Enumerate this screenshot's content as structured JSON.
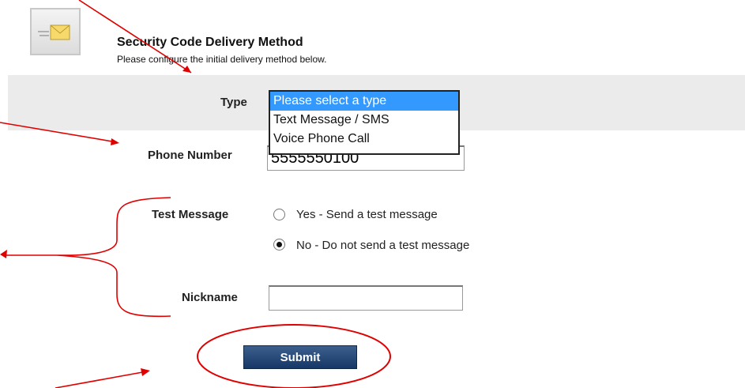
{
  "header": {
    "title": "Security Code Delivery Method",
    "subtitle": "Please configure the initial delivery method below."
  },
  "type": {
    "label": "Type",
    "options": [
      "Please select a type",
      "Text Message / SMS",
      "Voice Phone Call"
    ],
    "selected": "Please select a type"
  },
  "phone": {
    "label": "Phone Number",
    "value": "5555550100"
  },
  "test_message": {
    "label": "Test Message",
    "options": [
      {
        "label": "Yes - Send a test message",
        "checked": false
      },
      {
        "label": "No - Do not send a test message",
        "checked": true
      }
    ]
  },
  "nickname": {
    "label": "Nickname",
    "value": ""
  },
  "submit": {
    "label": "Submit"
  },
  "colors": {
    "annotation_red": "#e00000",
    "selected_option": "#3399ff",
    "submit_button": "#1f3f6d"
  },
  "icons": {
    "header_icon": "envelope-icon"
  }
}
